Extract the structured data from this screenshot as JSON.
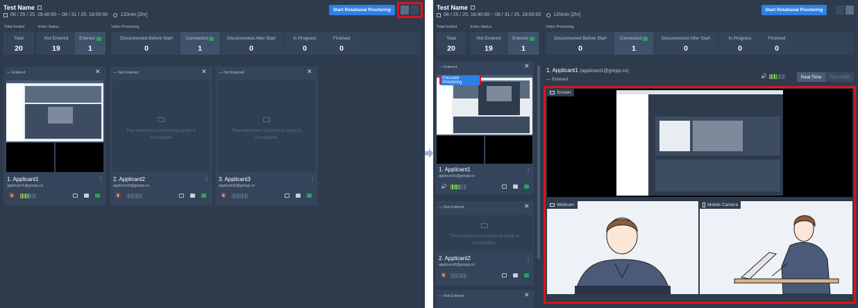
{
  "test": {
    "name": "Test Name",
    "schedule": "08 / 25 / 25, 18:40:00 ~ 08 / 31 / 25, 18:00:00",
    "duration": "120min [2hr]",
    "start_button": "Start Rotational Proctoring"
  },
  "groups": {
    "total_invited": "Total Invited",
    "entry_status": "Entry Status",
    "video_proctoring": "Video Proctoring"
  },
  "stats": [
    {
      "label": "Total",
      "value": "20"
    },
    {
      "label": "Not Entered",
      "value": "19"
    },
    {
      "label": "Entered",
      "value": "1"
    },
    {
      "label": "Disconnected Before Start",
      "value": "0"
    },
    {
      "label": "Connected",
      "value": "1"
    },
    {
      "label": "Disconnected After Start",
      "value": "0"
    },
    {
      "label": "In Progress",
      "value": "0"
    },
    {
      "label": "Finished",
      "value": "0"
    }
  ],
  "cards": [
    {
      "status": "Entered",
      "name": "1. Applicant1",
      "email": "applicant1@grepp.co"
    },
    {
      "status": "Not Entered",
      "name": "2. Applicant2",
      "email": "applicant2@grepp.co",
      "message": "The examinee's proctoring setup is incomplete."
    },
    {
      "status": "Not Entered",
      "name": "3. Applicant3",
      "email": "applicant3@grepp.co",
      "message": "The examinee's proctoring setup is incomplete."
    }
  ],
  "detail": {
    "applicant_name": "1. Applicant1",
    "applicant_email": "(applicant1@grepp.co)",
    "status": "Entered",
    "tab_realtime": "Real Time",
    "tab_timeshift": "Time Shift",
    "screen_label": "Screen",
    "webcam_label": "Webcam",
    "mobile_label": "Mobile Camera",
    "focused_label": "Focused Proctoring"
  },
  "sidebar_cards": [
    {
      "status": "Entered",
      "name": "1. Applicant1",
      "email": "applicant1@grepp.co"
    },
    {
      "status": "Not Entered",
      "name": "2. Applicant2",
      "email": "applicant2@grepp.co",
      "message": "The examinee's proctoring setup is incomplete."
    },
    {
      "status": "Not Entered"
    }
  ],
  "colors": {
    "accent": "#2f7fe6",
    "highlight": "#e0121b",
    "connected": "#21a65a",
    "background": "#2d3b4d"
  }
}
